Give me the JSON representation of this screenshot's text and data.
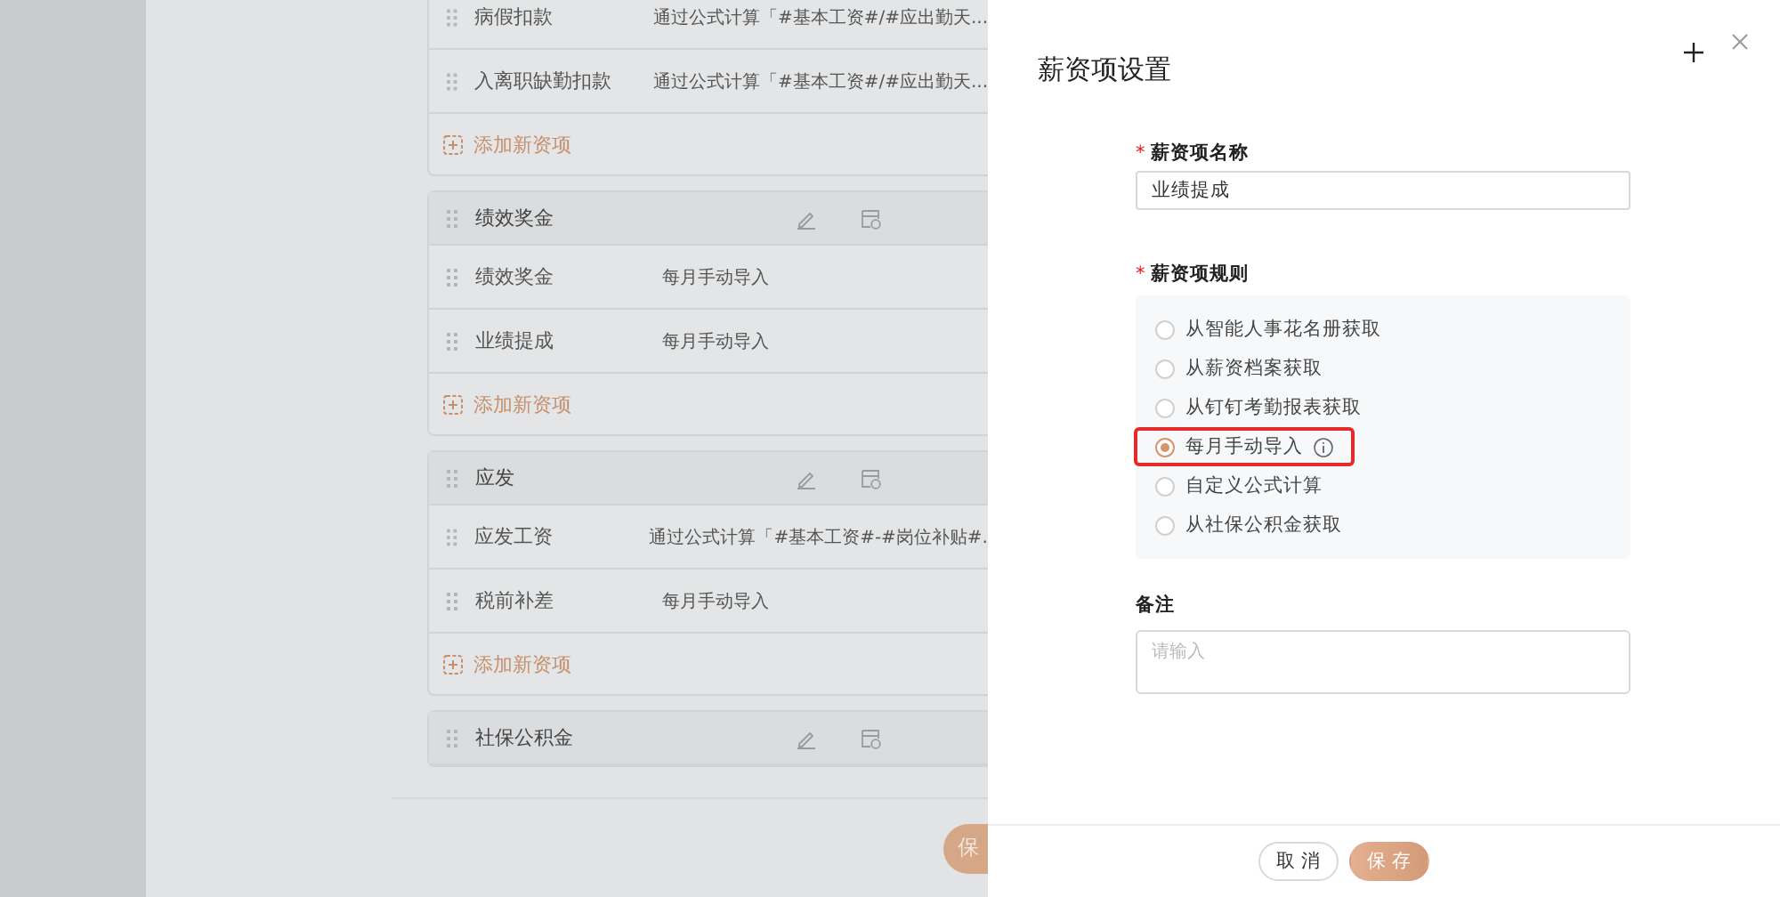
{
  "background": {
    "groups": [
      {
        "items": [
          {
            "name": "病假扣款",
            "rule": "通过公式计算「#基本工资#/#应出勤天..."
          },
          {
            "name": "入离职缺勤扣款",
            "rule": "通过公式计算「#基本工资#/#应出勤天..."
          }
        ],
        "add_label": "添加新资项"
      },
      {
        "header": "绩效奖金",
        "items": [
          {
            "name": "绩效奖金",
            "rule": "每月手动导入"
          },
          {
            "name": "业绩提成",
            "rule": "每月手动导入"
          }
        ],
        "add_label": "添加新资项"
      },
      {
        "header": "应发",
        "items": [
          {
            "name": "应发工资",
            "rule": "通过公式计算「#基本工资#-#岗位补贴#."
          },
          {
            "name": "税前补差",
            "rule": "每月手动导入"
          }
        ],
        "add_label": "添加新资项"
      },
      {
        "header": "社保公积金"
      }
    ],
    "footer_button": "保"
  },
  "drawer": {
    "title": "薪资项设置",
    "name_field": {
      "required_mark": "*",
      "label": "薪资项名称",
      "value": "业绩提成"
    },
    "rule_field": {
      "required_mark": "*",
      "label": "薪资项规则",
      "options": [
        {
          "label": "从智能人事花名册获取",
          "selected": false,
          "highlighted": false,
          "info": false
        },
        {
          "label": "从薪资档案获取",
          "selected": false,
          "highlighted": false,
          "info": false
        },
        {
          "label": "从钉钉考勤报表获取",
          "selected": false,
          "highlighted": false,
          "info": false
        },
        {
          "label": "每月手动导入",
          "selected": true,
          "highlighted": true,
          "info": true
        },
        {
          "label": "自定义公式计算",
          "selected": false,
          "highlighted": false,
          "info": false
        },
        {
          "label": "从社保公积金获取",
          "selected": false,
          "highlighted": false,
          "info": false
        }
      ]
    },
    "note_field": {
      "label": "备注",
      "placeholder": "请输入"
    },
    "buttons": [
      {
        "label": "取 消",
        "kind": "secondary"
      },
      {
        "label": "保 存",
        "kind": "primary"
      }
    ]
  }
}
